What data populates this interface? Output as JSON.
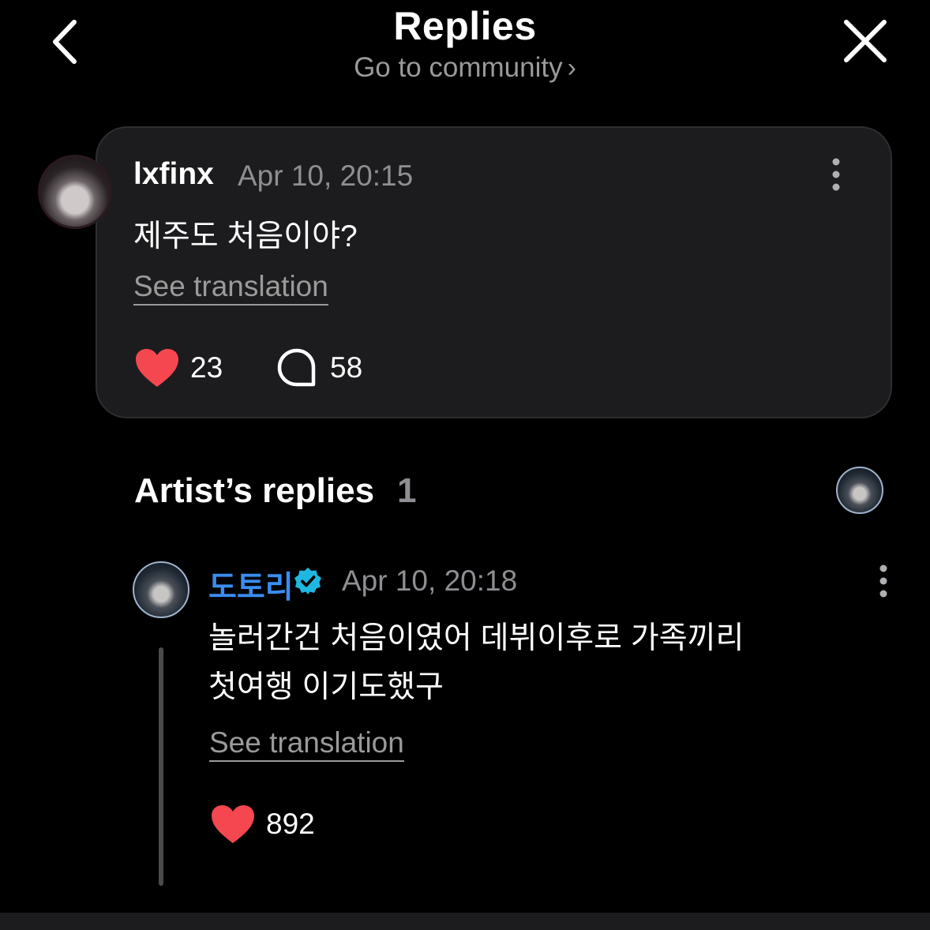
{
  "header": {
    "title": "Replies",
    "community_link": "Go to community",
    "chevron": "›",
    "back_icon": "chevron-left-icon",
    "close_icon": "close-icon"
  },
  "comment": {
    "username": "lxfinx",
    "date": "Apr 10, 20:15",
    "text": "제주도 처음이야?",
    "see_translation": "See translation",
    "likes": "23",
    "replies": "58"
  },
  "artist_replies": {
    "label": "Artist’s replies",
    "count": "1",
    "reply": {
      "username": "도토리",
      "date": "Apr 10, 20:18",
      "text_line1": "놀러간건 처음이였어 데뷔이후로 가족끼리",
      "text_line2": "첫여행 이기도했구",
      "see_translation": "See translation",
      "likes": "892"
    }
  },
  "colors": {
    "background": "#000000",
    "card": "#1c1c1e",
    "heart": "#f5474f",
    "artist_name": "#3a8df0",
    "verified_badge": "#1fb6e0",
    "muted_text": "#8e8e93"
  }
}
